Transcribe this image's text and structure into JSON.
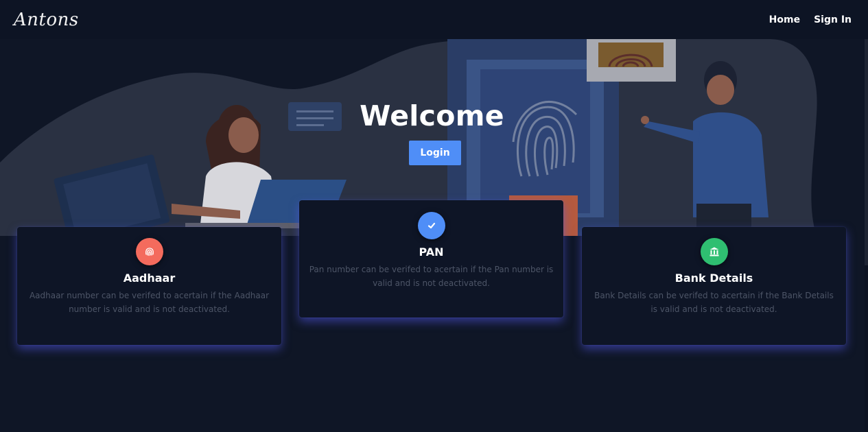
{
  "navbar": {
    "brand": "Antons",
    "links": [
      {
        "label": "Home"
      },
      {
        "label": "Sign In"
      }
    ]
  },
  "hero": {
    "title": "Welcome",
    "button_label": "Login"
  },
  "cards": [
    {
      "title": "Aadhaar",
      "description": "Aadhaar number can be verifed to acertain if the Aadhaar number is valid and is not deactivated.",
      "icon": "fingerprint-icon",
      "icon_color": "#f46b5d"
    },
    {
      "title": "PAN",
      "description": "Pan number can be verifed to acertain if the Pan number is valid and is not deactivated.",
      "icon": "check-icon",
      "icon_color": "#4f8ef7"
    },
    {
      "title": "Bank Details",
      "description": "Bank Details can be verifed to acertain if the Bank Details is valid and is not deactivated.",
      "icon": "bank-icon",
      "icon_color": "#2fbf71"
    }
  ],
  "colors": {
    "background": "#0f1626",
    "accent": "#4f8ef7",
    "card_glow": "#5258e6"
  }
}
